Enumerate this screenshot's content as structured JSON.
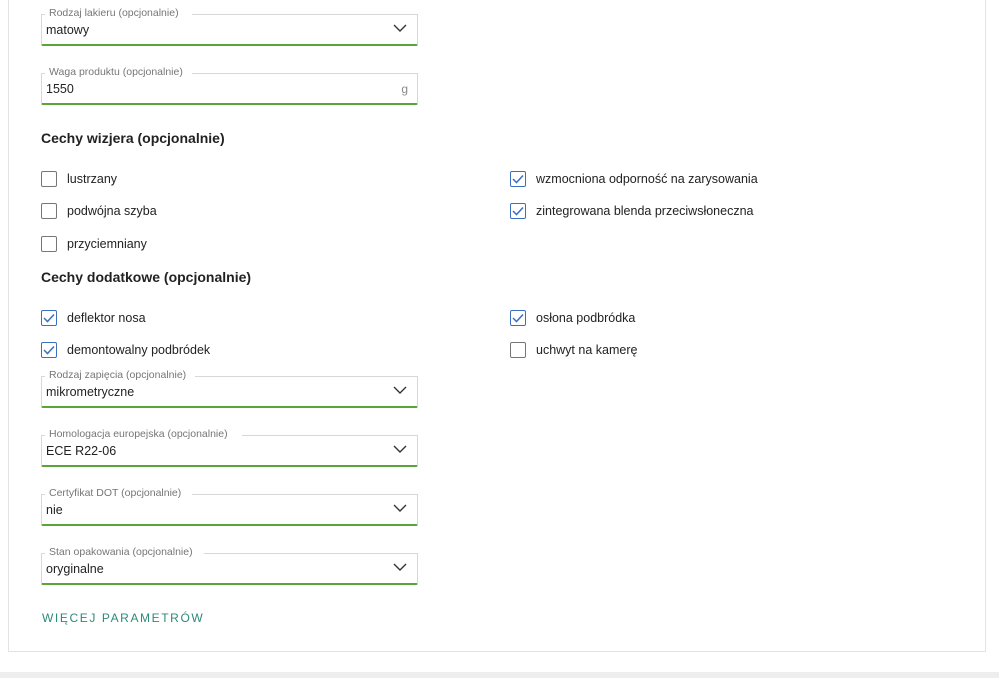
{
  "fields": {
    "paint_type": {
      "label": "Rodzaj lakieru (opcjonalnie)",
      "value": "matowy"
    },
    "weight": {
      "label": "Waga produktu (opcjonalnie)",
      "value": "1550",
      "unit": "g"
    },
    "fastening": {
      "label": "Rodzaj zapięcia (opcjonalnie)",
      "value": "mikrometryczne"
    },
    "homologation": {
      "label": "Homologacja europejska (opcjonalnie)",
      "value": "ECE R22-06"
    },
    "dot": {
      "label": "Certyfikat DOT (opcjonalnie)",
      "value": "nie"
    },
    "packaging": {
      "label": "Stan opakowania (opcjonalnie)",
      "value": "oryginalne"
    }
  },
  "visor": {
    "title": "Cechy wizjera (opcjonalnie)",
    "options": [
      {
        "label": "lustrzany",
        "checked": false
      },
      {
        "label": "wzmocniona odporność na zarysowania",
        "checked": true
      },
      {
        "label": "podwójna szyba",
        "checked": false
      },
      {
        "label": "zintegrowana blenda przeciwsłoneczna",
        "checked": true
      },
      {
        "label": "przyciemniany",
        "checked": false
      }
    ]
  },
  "extra": {
    "title": "Cechy dodatkowe (opcjonalnie)",
    "options": [
      {
        "label": "deflektor nosa",
        "checked": true
      },
      {
        "label": "osłona podbródka",
        "checked": true
      },
      {
        "label": "demontowalny podbródek",
        "checked": true
      },
      {
        "label": "uchwyt na kamerę",
        "checked": false
      }
    ]
  },
  "more_link": "WIĘCEJ PARAMETRÓW",
  "colors": {
    "accent_green": "#5aa53a",
    "checkbox_blue": "#3b6fc0",
    "link_teal": "#2c8a7a"
  }
}
